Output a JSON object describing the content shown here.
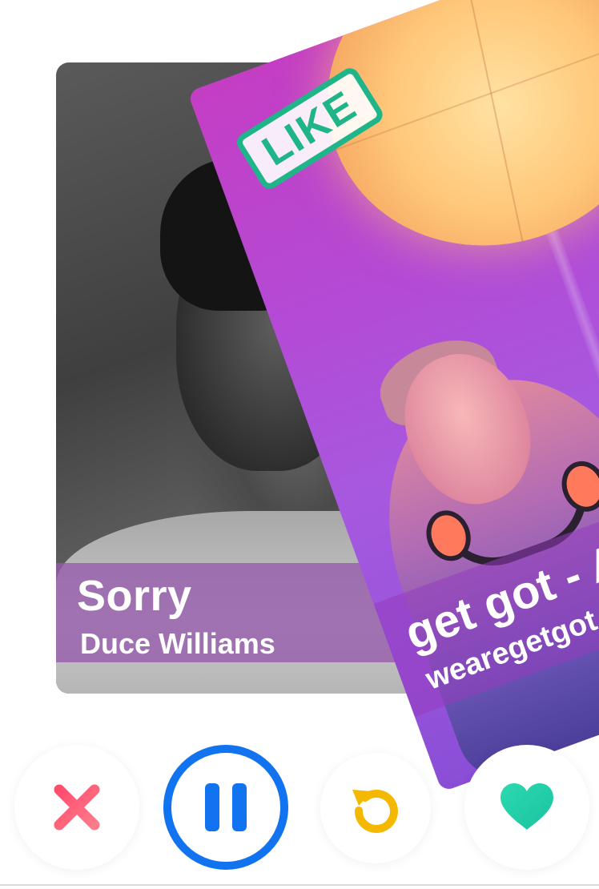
{
  "back_card": {
    "title": "Sorry",
    "artist": "Duce Williams"
  },
  "front_card": {
    "title": "get got - Ar",
    "artist": "wearegetgot",
    "stamp": "LIKE"
  },
  "controls": {
    "dislike_icon": "close-x-icon",
    "pause_icon": "pause-icon",
    "undo_icon": "undo-icon",
    "like_icon": "heart-icon"
  },
  "colors": {
    "like_green": "#1fb589",
    "pause_blue": "#1273f0",
    "undo_yellow": "#f5b800",
    "dislike_red": "#fd5068",
    "heart_teal": "#21d6a6"
  }
}
